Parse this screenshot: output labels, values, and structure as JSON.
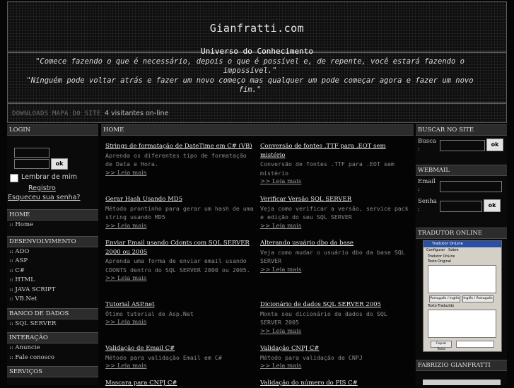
{
  "header": {
    "site_title": "Gianfratti.com",
    "subtitle": "Universo do Conhecimento",
    "quote_1": "\"Comece fazendo o que é necessário, depois o que é possível e, de repente, você estará fazendo o impossível.\"",
    "quote_2": "\"Ninguém pode voltar atrás e fazer um novo começo mas qualquer um pode começar agora e fazer um novo fim.\""
  },
  "nav": {
    "downloads": "DOWNLOADS",
    "sitemap": "MAPA DO SITE",
    "visitors": "4 visitantes on-line"
  },
  "left": {
    "login_title": "LOGIN",
    "ok_label": "ok",
    "remember_label": "Lembrar de mim",
    "register_label": "Registro",
    "forgot_label": "Esqueceu sua senha?",
    "home_title": "HOME",
    "home_link": ":: Home",
    "dev_title": "DESENVOLVIMENTO",
    "dev_links": [
      ":: ADO",
      ":: ASP",
      ":: C#",
      ":: HTML",
      ":: JAVA SCRIPT",
      ":: VB.Net"
    ],
    "db_title": "BANCO DE DADOS",
    "db_link": ":: SQL SERVER",
    "interaction_title": "INTERAÇÃO",
    "interaction_links": [
      ":: Anuncie",
      ":: Fale conosco"
    ],
    "services_title": "SERVIÇOS"
  },
  "main": {
    "heading": "HOME",
    "read_more": ">> Leia mais",
    "articles": [
      {
        "title": "Strings de formatação de DateTime em C# (VB)",
        "desc": "Aprenda os diferentes tipo de formatação de Data e Hora."
      },
      {
        "title": "Conversão de fontes .TTF para .EOT sem mistério",
        "desc": "Conversão de fontes .TTF para .EOT sem mistério"
      },
      {
        "title": "Gerar Hash Usando MD5",
        "desc": "Método prontinho para gerar um hash de uma string usando MD5"
      },
      {
        "title": "Verificar Versão SQL SERVER",
        "desc": "Veja como verificar a versão, service pack e edição do seu SQL SERVER"
      },
      {
        "title": "Enviar Email usando Cdonts com SQL SERVER 2000 ou 2005",
        "desc": "Aprenda uma forma de enviar email usando CDONTS dentro do SQL SERVER 2000 ou 2005."
      },
      {
        "title": "Alterando usuário dbo da base",
        "desc": "Veja como mudar o usuário dbo da base SQL SERVER"
      },
      {
        "title": "Tutorial ASP.net",
        "desc": "Ótimo tutorial de Asp.Net"
      },
      {
        "title": "Dicionário de dados SQL SERVER 2005",
        "desc": "Monte seu dicionário de dados do SQL SERVER 2005"
      },
      {
        "title": "Validação de Email C#",
        "desc": "Método para validação Email em C#"
      },
      {
        "title": "Validação CNPJ C#",
        "desc": "Método para validação de CNPJ"
      },
      {
        "title": "Mascara para CNPJ C#",
        "desc": ""
      },
      {
        "title": "Validação do número do PIS C#",
        "desc": ""
      }
    ]
  },
  "right": {
    "search_title": "BUSCAR NO SITE",
    "search_label": "Busca",
    "colon": ":",
    "ok_label": "ok",
    "webmail_title": "WEBMAIL",
    "email_label": "Email",
    "password_label": "Senha",
    "translator_title": "TRADUTOR ONLINE",
    "translator_window_title": "Tradutor OnLine",
    "translator_menu": [
      "Configurar",
      "Sobre"
    ],
    "translator_section": "Tradutor OnLine",
    "translator_original": "Texto Original",
    "translator_btn_1": "Português / Inglês",
    "translator_btn_2": "Inglês / Português",
    "translator_translated": "Texto Traduzido",
    "translator_copy": "Copiar Texto",
    "author_title": "FABRIZIO GIANFRATTI"
  }
}
